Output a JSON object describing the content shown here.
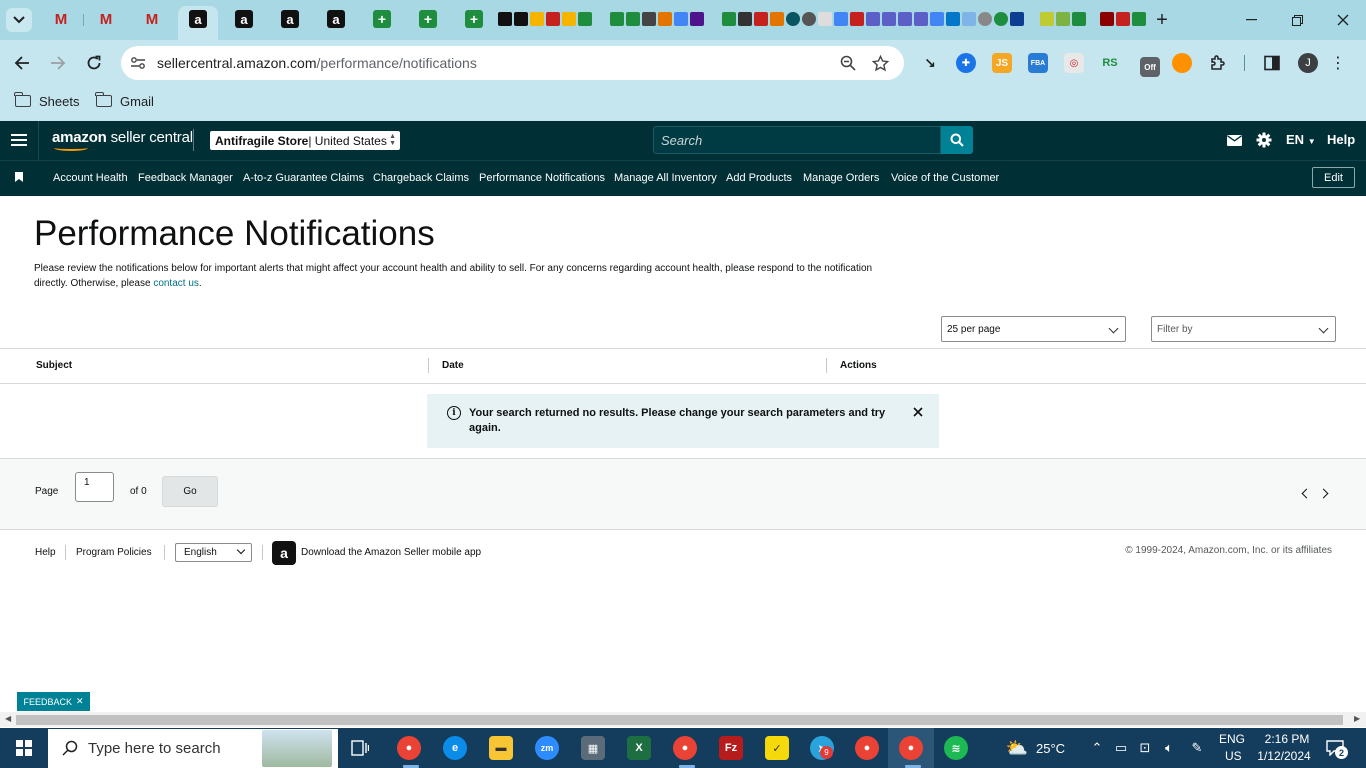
{
  "browser": {
    "url_host": "sellercentral.amazon.com",
    "url_path": "/performance/notifications",
    "profile_initial": "J",
    "extensions": [
      "JS",
      "FBA",
      "RS",
      "Off"
    ],
    "bookmarks": [
      "Sheets",
      "Gmail"
    ]
  },
  "header": {
    "logo_brand": "amazon",
    "logo_product": " seller central",
    "store_name": "Antifragile Store",
    "store_marketplace": " | United States",
    "search_placeholder": "Search",
    "language": "EN",
    "help": "Help"
  },
  "nav": {
    "links": [
      "Account Health",
      "Feedback Manager",
      "A-to-z Guarantee Claims",
      "Chargeback Claims",
      "Performance Notifications",
      "Manage All Inventory",
      "Add Products",
      "Manage Orders",
      "Voice of the Customer"
    ],
    "edit": "Edit"
  },
  "main": {
    "title": "Performance Notifications",
    "description_1": "Please review the notifications below for important alerts that might affect your account health and ability to sell. For any concerns regarding account health, please respond to the notification directly. Otherwise, please ",
    "description_link": "contact us",
    "description_2": ".",
    "per_page": "25 per page",
    "filter": "Filter by",
    "columns": [
      "Subject",
      "Date",
      "Actions"
    ],
    "alert": "Your search returned no results. Please change your search parameters and try again."
  },
  "pager": {
    "page_label": "Page",
    "page_value": "1",
    "of_label": "of 0",
    "go": "Go"
  },
  "footer": {
    "help": "Help",
    "policies": "Program Policies",
    "language": "English",
    "app_text": "Download the Amazon Seller mobile app",
    "copyright": "© 1999-2024, Amazon.com, Inc. or its affiliates",
    "feedback": "FEEDBACK"
  },
  "taskbar": {
    "search_placeholder": "Type here to search",
    "weather": "25°C",
    "lang_1": "ENG",
    "lang_2": "US",
    "time": "2:16 PM",
    "date": "1/12/2024",
    "notification_count": "2",
    "badge_a": "9"
  },
  "colors": {
    "header_bg": "#002f36",
    "accent": "#008296",
    "alert_bg": "#e6f2f3",
    "link": "#007185",
    "chrome_bg": "#c5e6ee",
    "tabstrip_bg": "#a8d8e4",
    "taskbar_bg": "#143c5c"
  }
}
